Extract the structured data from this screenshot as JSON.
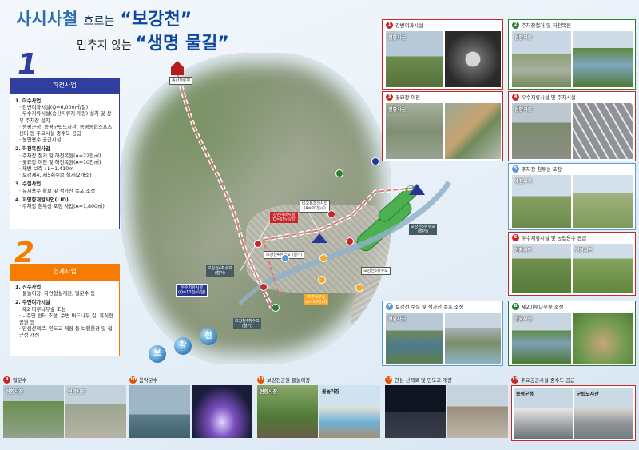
{
  "title": {
    "line1_a": "사시사철",
    "line1_b": "흐르는",
    "line1_c": "“보강천”",
    "line2_a": "멈추지 않는",
    "line2_b": "“생명 물길”"
  },
  "section1": {
    "number": "1",
    "heading": "하천사업",
    "groups": [
      {
        "title": "1. 이수사업",
        "items": [
          "강변여과시설(Q=6,000㎥/일)",
          "우수저류시설(송산저류지 개량) 설치 및 상부 주차장 설치",
          "증평군청, 증평군립도서관, 증평종합스포츠센터 등 주요시설 중수도 공급",
          "농업용수 공급시설"
        ]
      },
      {
        "title": "2. 하천복원사업",
        "items": [
          "주차장 철거 및 하천복원(A=22천㎡)",
          "꽃묘장 이전 및 하천복원(A=10천㎡)",
          "제방 보축 : L=1,410m",
          "보강제4, 제5취수보 철거(2개소)"
        ]
      },
      {
        "title": "3. 수질사업",
        "items": [
          "유지용수 확보 및 석가산 폭포 조성"
        ]
      },
      {
        "title": "4. 저영향개발사업(LID)",
        "items": [
          "주차장 침투성 포장 사업(A=1,800㎡)"
        ]
      }
    ]
  },
  "section2": {
    "number": "2",
    "heading": "연계사업",
    "groups": [
      {
        "title": "1. 친수사업",
        "items": [
          "물놀이장, 자연형실개천, 밀분수 등"
        ]
      },
      {
        "title": "2. 주민여가시설",
        "items": [
          "제2 미루나무숲 조성",
          "– 주민 쉼터 조성, 수변 버드나무 길, 휴식형 공원 등",
          "안심산책로, 인도교 개량 등 보행환경 및 접근성 개선"
        ]
      }
    ]
  },
  "map": {
    "labels": {
      "top": "송산저류지",
      "gangbyeon": "강변여과시설\n(Q=6천㎥/일)",
      "biotope": "비오톱조성사업\n(A=20천㎡)",
      "center_white": "보강천4취수보\n(철거)",
      "navy": "우수저류시설\n(Q=10천㎥/일)",
      "right_gray": "보강천5취수보\n(철거)",
      "right_white": "보강천5취수보",
      "orange": "미루나무숲\n(A=13천㎡)",
      "bottom": "보강천4취수보\n(철거)"
    },
    "balls": [
      "보",
      "강",
      "천"
    ]
  },
  "cards": [
    {
      "num": "1",
      "title": "강변여과시설",
      "color": "#c62828",
      "labels": [
        "현황사진",
        ""
      ]
    },
    {
      "num": "2",
      "title": "주차장철거 및 하천복원",
      "color": "#2e7d32",
      "labels": [
        "현황사진",
        ""
      ]
    },
    {
      "num": "3",
      "title": "꽃묘장 이전",
      "color": "#c62828",
      "labels": [
        "현황사진",
        ""
      ]
    },
    {
      "num": "4",
      "title": "우수저류시설 및 주차시설",
      "color": "#c62828",
      "labels": [
        "현황사진",
        ""
      ]
    },
    {
      "num": "5",
      "title": "주차장 침투성 포장",
      "color": "#5b9bd5",
      "labels": [
        "예정부지",
        ""
      ]
    },
    {
      "num": "6",
      "title": "우수저류시설 및 농업용수 공급",
      "color": "#c62828",
      "labels": [
        "현황사진",
        "현황사진"
      ]
    },
    {
      "num": "7",
      "title": "보강천 수질 및 석가산 폭포 조성",
      "color": "#5b9bd5",
      "labels": [
        "현황사진",
        ""
      ]
    },
    {
      "num": "8",
      "title": "제2미루나무숲 조성",
      "color": "#2e7d32",
      "labels": [
        "현황사진",
        ""
      ]
    },
    {
      "num": "9",
      "title": "밀분수",
      "color": "#c62828",
      "labels": [
        "현황사진",
        "현황사진"
      ]
    },
    {
      "num": "10",
      "title": "음악분수",
      "color": "#e65100",
      "labels": [
        "",
        ""
      ]
    },
    {
      "num": "11",
      "title": "보강천공원 물놀이장",
      "color": "#e65100",
      "labels": [
        "현황사진",
        "물놀이장"
      ]
    },
    {
      "num": "12",
      "title": "안심 산책로 및 인도교 개량",
      "color": "#e65100",
      "labels": [
        "",
        ""
      ]
    },
    {
      "num": "13",
      "title": "주요공공시설 중수도 공급",
      "color": "#c62828",
      "labels": [
        "증평군청",
        "군립도서관"
      ]
    }
  ]
}
